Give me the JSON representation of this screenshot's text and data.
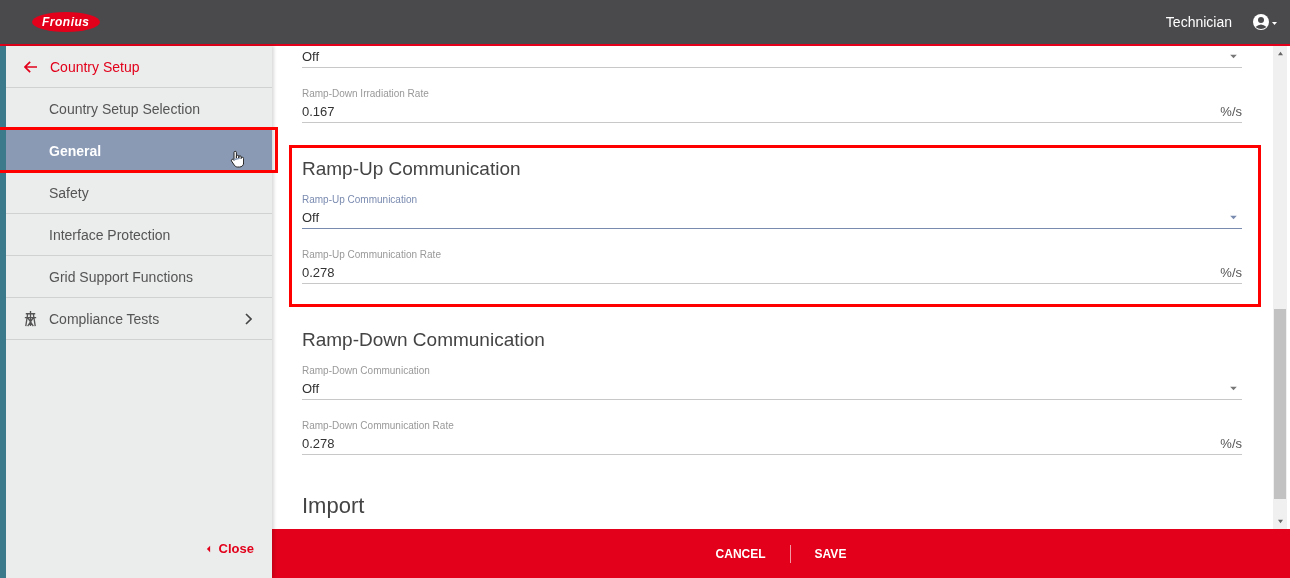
{
  "header": {
    "logo": "Fronius",
    "user": "Technician"
  },
  "sidebar": {
    "back": {
      "label": "Country Setup"
    },
    "items": [
      {
        "label": "Country Setup Selection",
        "selected": false,
        "highlighted": false,
        "kind": "page"
      },
      {
        "label": "General",
        "selected": true,
        "highlighted": true,
        "kind": "page"
      },
      {
        "label": "Safety",
        "selected": false,
        "highlighted": false,
        "kind": "page"
      },
      {
        "label": "Interface Protection",
        "selected": false,
        "highlighted": false,
        "kind": "page"
      },
      {
        "label": "Grid Support Functions",
        "selected": false,
        "highlighted": false,
        "kind": "page"
      },
      {
        "label": "Compliance Tests",
        "selected": false,
        "highlighted": false,
        "kind": "group"
      }
    ],
    "close": "Close"
  },
  "sections": [
    {
      "highlighted": false,
      "fields": [
        {
          "kind": "select",
          "value": "Off",
          "focused": false
        },
        {
          "kind": "number",
          "label": "Ramp-Down Irradiation Rate",
          "value": "0.167",
          "unit": "%/s",
          "focused": false
        }
      ]
    },
    {
      "title": "Ramp-Up Communication",
      "highlighted": true,
      "fields": [
        {
          "kind": "select",
          "label": "Ramp-Up Communication",
          "value": "Off",
          "focused": true
        },
        {
          "kind": "number",
          "label": "Ramp-Up Communication Rate",
          "value": "0.278",
          "unit": "%/s",
          "focused": false
        }
      ]
    },
    {
      "title": "Ramp-Down Communication",
      "highlighted": false,
      "fields": [
        {
          "kind": "select",
          "label": "Ramp-Down Communication",
          "value": "Off",
          "focused": false
        },
        {
          "kind": "number",
          "label": "Ramp-Down Communication Rate",
          "value": "0.278",
          "unit": "%/s",
          "focused": false
        }
      ]
    },
    {
      "title": "Import",
      "highlighted": false
    }
  ],
  "footer": {
    "buttons": [
      "CANCEL",
      "SAVE"
    ]
  }
}
